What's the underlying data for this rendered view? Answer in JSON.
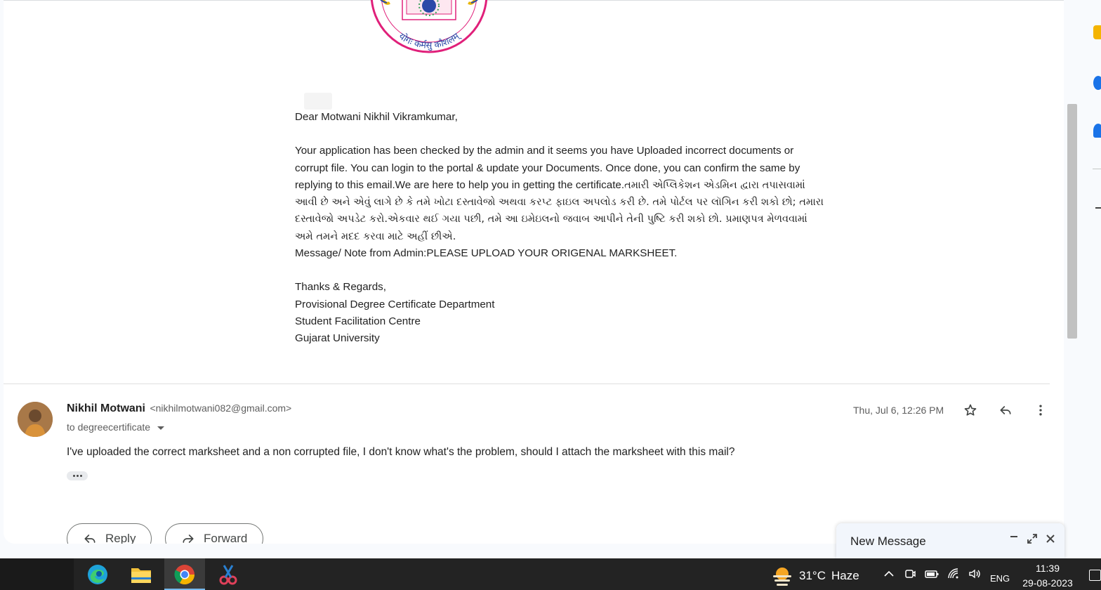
{
  "logo": {
    "motto": "योगः कर्मसु कौशलम्"
  },
  "email": {
    "greeting": "Dear Motwani Nikhil Vikramkumar,",
    "body_english": "Your application has been checked by the admin and it seems you have Uploaded incorrect documents or corrupt file. You can login to the portal & update your Documents. Once done, you can confirm the same by replying to this email.We are here to help you in getting the certificate.",
    "body_gujarati": "તમારી એપ્લિકેશન એડમિન દ્વારા તપાસવામાં આવી છે અને એવું લાગે છે કે તમે ખોટા દસ્તાવેજો અથવા કરપ્ટ ફાઇલ અપલોડ કરી છે. તમે પોર્ટલ પર લૉગિન કરી શકો છો; તમારા દસ્તાવેજો અપડેટ કરો.એકવાર થઈ ગયા પછી, તમે આ ઇમેઇલનો જવાબ આપીને તેની પુષ્ટિ કરી શકો છો. પ્રમાણપત્ર મેળવવામાં અમે તમને મદદ કરવા માટે અહીં છીએ.",
    "admin_note": "Message/ Note from Admin:PLEASE UPLOAD YOUR ORIGENAL MARKSHEET.",
    "signature": [
      "Thanks & Regards,",
      "Provisional Degree Certificate Department",
      "Student Facilitation Centre",
      "Gujarat University"
    ]
  },
  "reply_message": {
    "sender_name": "Nikhil Motwani",
    "sender_email": "<nikhilmotwani082@gmail.com>",
    "to_label": "to degreecertificate",
    "date": "Thu, Jul 6, 12:26 PM",
    "text": "I've uploaded the correct marksheet and a non corrupted file, I don't know what's the problem, should I attach the marksheet with this mail?"
  },
  "actions": {
    "reply_label": "Reply",
    "forward_label": "Forward"
  },
  "compose": {
    "title": "New Message"
  },
  "taskbar": {
    "weather_temp": "31°C",
    "weather_desc": "Haze",
    "language": "ENG",
    "time": "11:39",
    "date": "29-08-2023"
  },
  "colors": {
    "logo_ring": "#e0207a",
    "logo_gold": "#e8b500",
    "logo_blue": "#2b4aa8",
    "taskbar_bg": "#232323"
  }
}
